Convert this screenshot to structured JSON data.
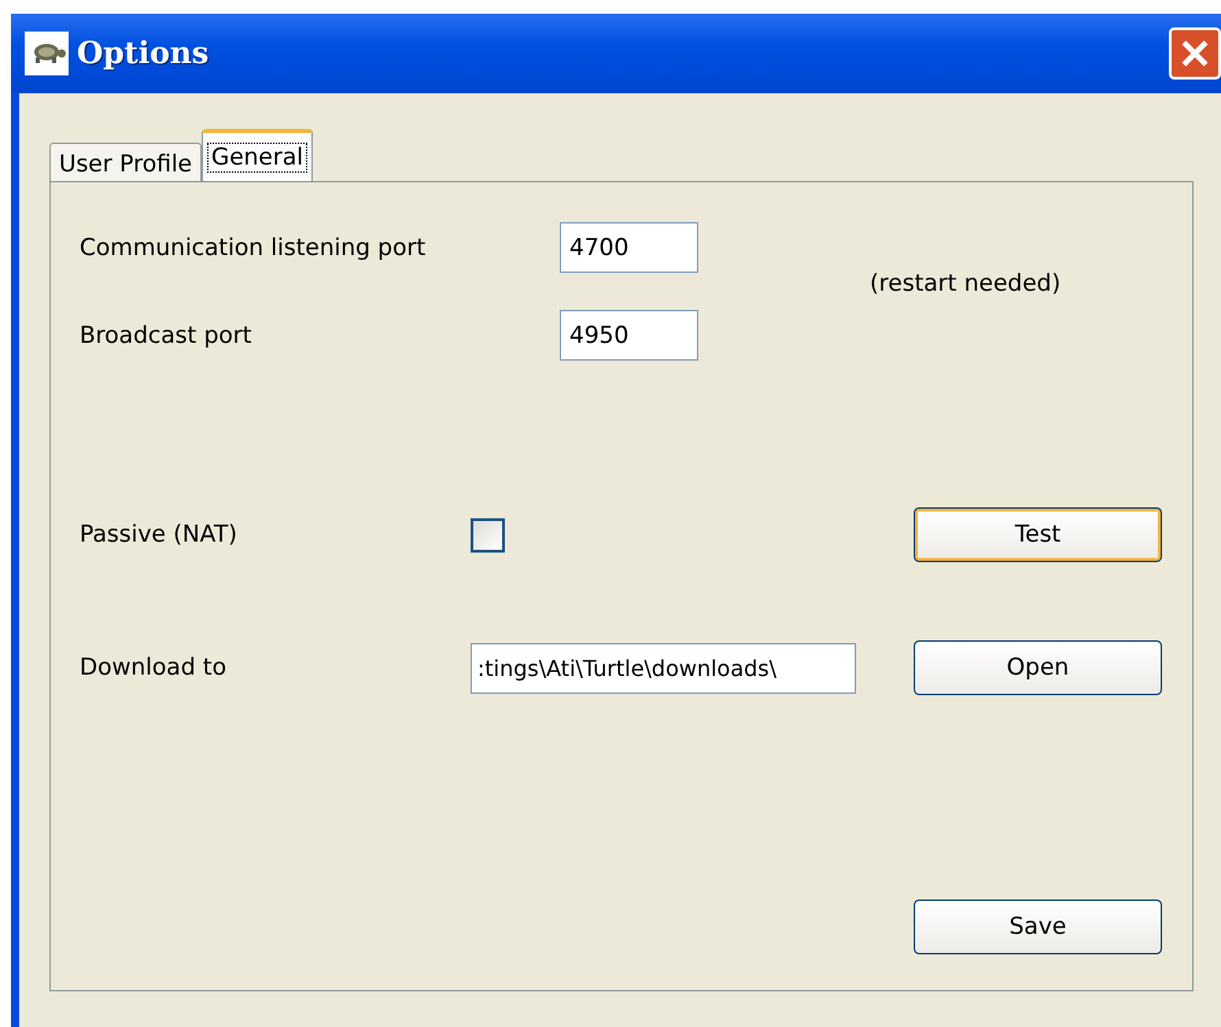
{
  "window": {
    "title": "Options"
  },
  "tabs": [
    {
      "label": "User Profile",
      "selected": false
    },
    {
      "label": "General",
      "selected": true
    }
  ],
  "fields": [
    {
      "label": "Communication listening port",
      "value": "4700"
    },
    {
      "label": "Broadcast port",
      "value": "4950"
    }
  ],
  "restart_note": "(restart needed)",
  "passive": {
    "label": "Passive (NAT)",
    "checked": false,
    "button": "Test",
    "focused": true
  },
  "download": {
    "label": "Download to",
    "value": ":tings\\Ati\\Turtle\\downloads\\",
    "button": "Open"
  },
  "save_button": "Save"
}
